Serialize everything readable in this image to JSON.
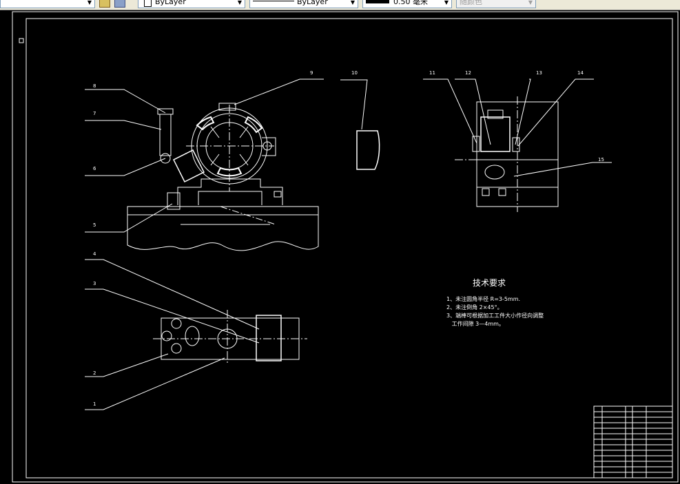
{
  "toolbar": {
    "layer_control": "ByLayer",
    "linetype_control": "ByLayer",
    "lineweight_value": "0.50",
    "lineweight_unit": "毫米",
    "plotstyle_control": "随颜色"
  },
  "drawing": {
    "part_numbers": [
      "1",
      "2",
      "3",
      "4",
      "5",
      "6",
      "7",
      "8",
      "9",
      "10",
      "11",
      "12",
      "13",
      "14",
      "15"
    ],
    "tech_title": "技术要求",
    "tech_items": [
      "1、未注圆角半径  R=3-5mm.",
      "2、未注倒角 2×45°。",
      "3、端棒可根据加工工件大小作径向调整",
      "   工作间隙 3—4mm。"
    ]
  },
  "colors": {
    "background": "#000000",
    "lines": "#ffffff",
    "toolbar": "#ece9d8"
  }
}
